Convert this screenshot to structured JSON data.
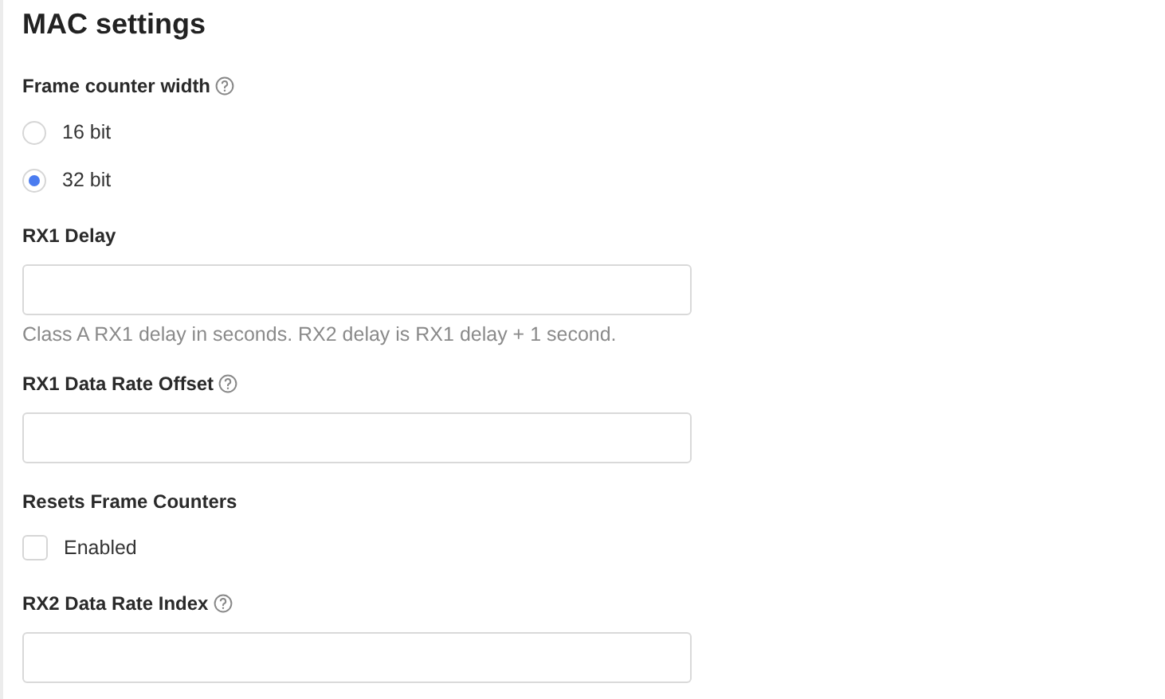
{
  "title": "MAC settings",
  "fields": [
    {
      "kind": "radio",
      "label": "Frame counter width",
      "help": true,
      "options": [
        {
          "label": "16 bit",
          "selected": false
        },
        {
          "label": "32 bit",
          "selected": true
        }
      ]
    },
    {
      "kind": "text",
      "label": "RX1 Delay",
      "help": false,
      "hint": "Class A RX1 delay in seconds. RX2 delay is RX1 delay + 1 second."
    },
    {
      "kind": "text",
      "label": "RX1 Data Rate Offset",
      "help": true
    },
    {
      "kind": "checkbox",
      "label": "Resets Frame Counters",
      "help": false,
      "option": "Enabled",
      "checked": false
    },
    {
      "kind": "text",
      "label": "RX2 Data Rate Index",
      "help": true
    }
  ]
}
